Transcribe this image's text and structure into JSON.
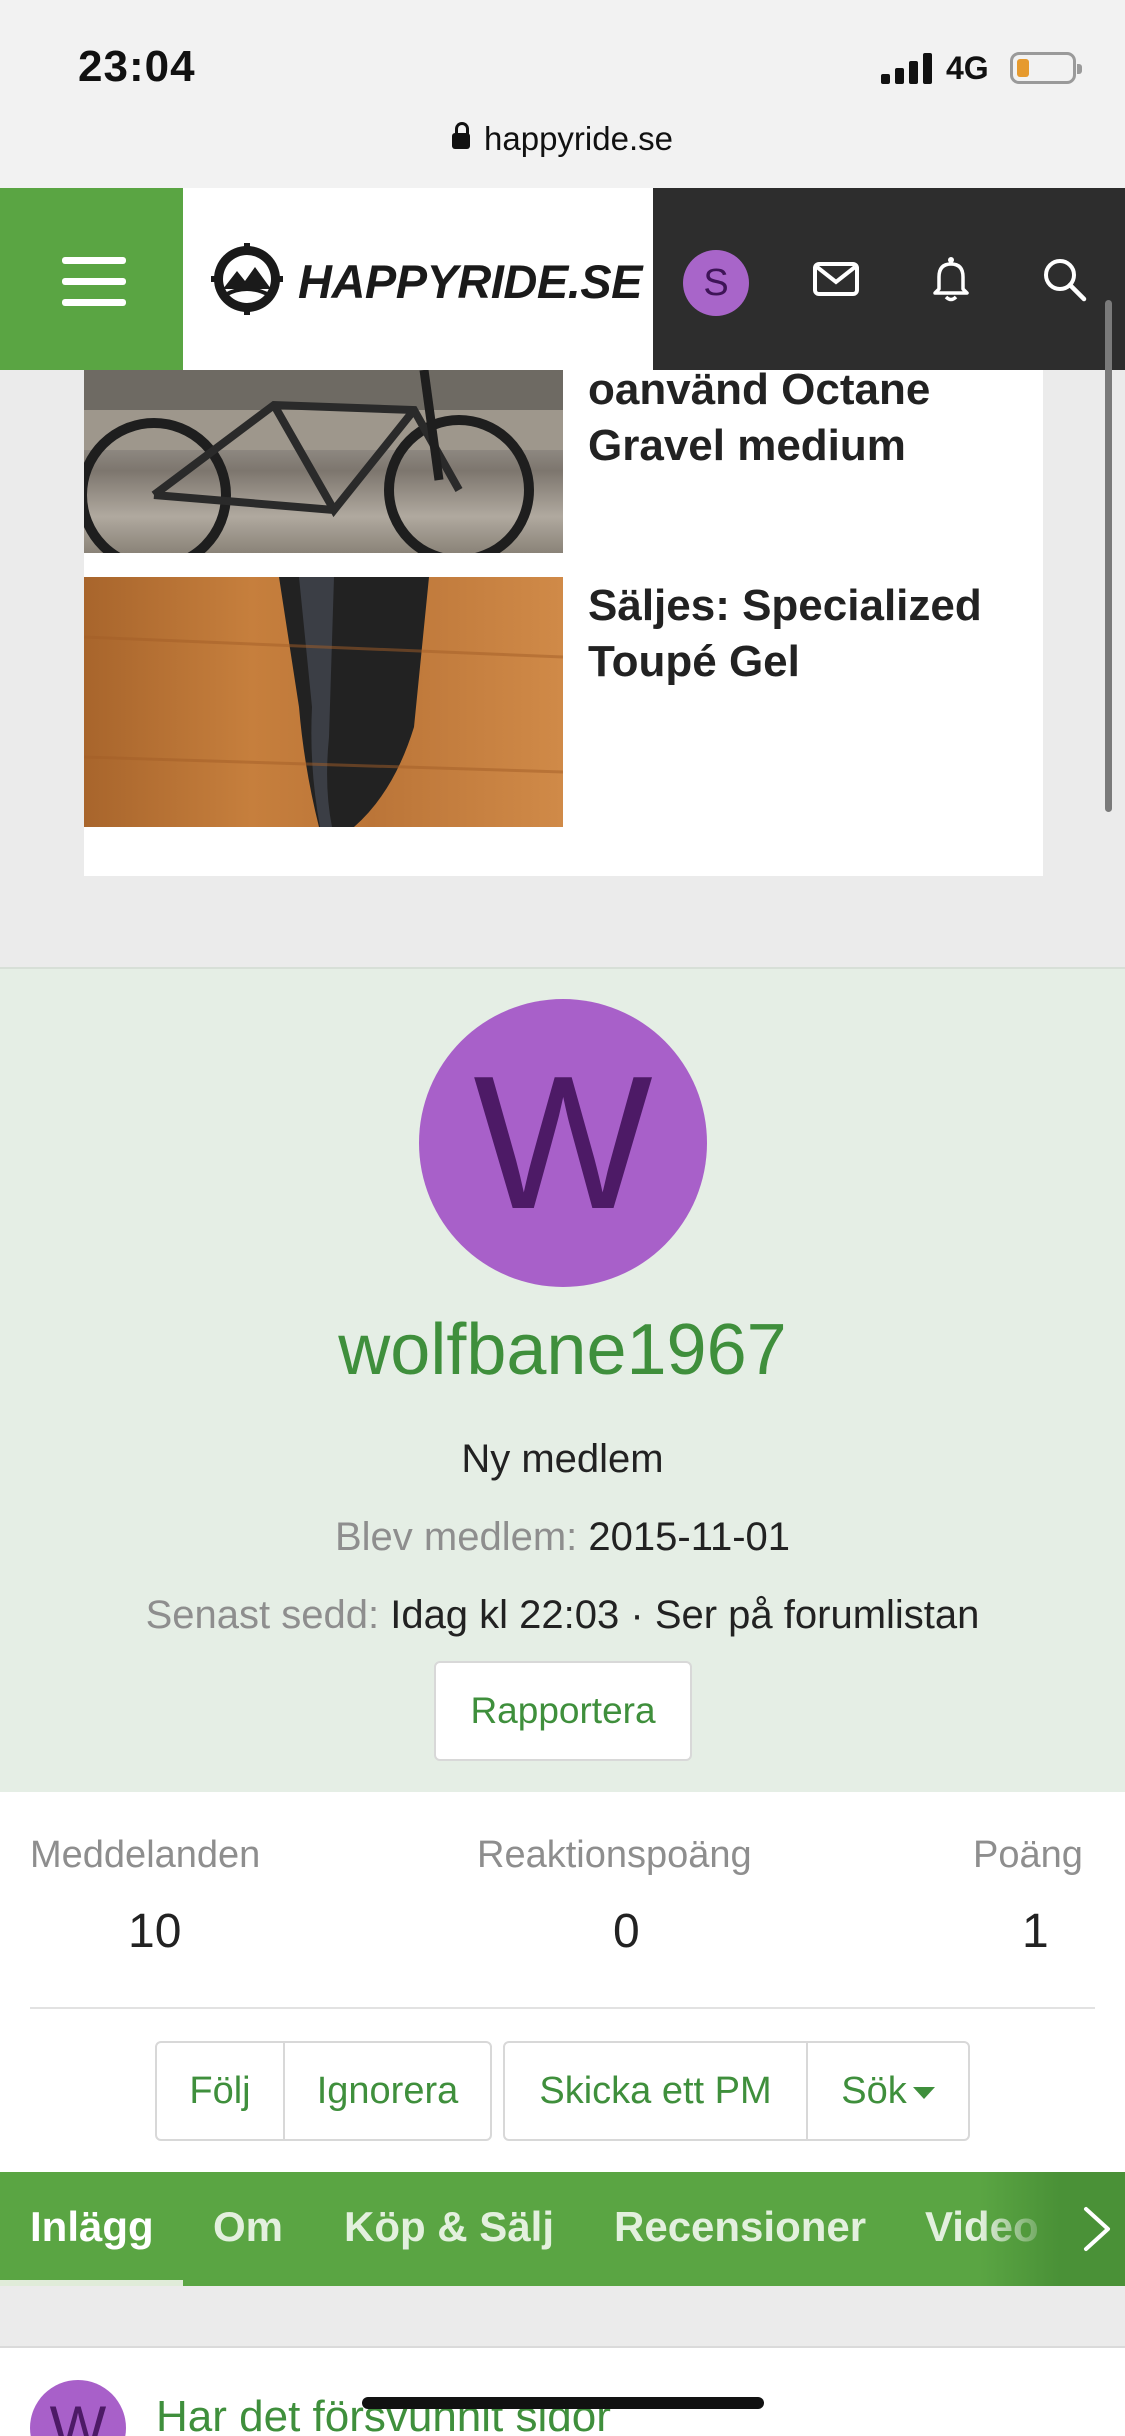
{
  "status_bar": {
    "time": "23:04",
    "network": "4G"
  },
  "browser": {
    "url": "happyride.se"
  },
  "header": {
    "logo_text": "HAPPYRIDE.SE",
    "user_initial": "S"
  },
  "listings": [
    {
      "title": "oanvänd Octane Gravel medium"
    },
    {
      "title": "Säljes: Specialized Toupé Gel"
    }
  ],
  "profile": {
    "avatar_initial": "W",
    "username": "wolfbane1967",
    "rank": "Ny medlem",
    "joined_label": "Blev medlem:",
    "joined_value": "2015-11-01",
    "last_seen_label": "Senast sedd:",
    "last_seen_value": "Idag kl 22:03 · Ser på forumlistan",
    "report_label": "Rapportera"
  },
  "stats": {
    "messages_label": "Meddelanden",
    "messages_value": "10",
    "reaction_label": "Reaktionspoäng",
    "reaction_value": "0",
    "points_label": "Poäng",
    "points_value": "1"
  },
  "actions": {
    "follow": "Följ",
    "ignore": "Ignorera",
    "pm": "Skicka ett PM",
    "search": "Sök"
  },
  "tabs": [
    "Inlägg",
    "Om",
    "Köp & Sälj",
    "Recensioner",
    "Video"
  ],
  "post_preview": {
    "avatar_initial": "W",
    "title": "Har det försvunnit sidor"
  },
  "colors": {
    "brand_green": "#5aa543",
    "link_green": "#3f8f3c",
    "avatar_purple": "#a860c9",
    "header_dark": "#2d2d2d"
  }
}
